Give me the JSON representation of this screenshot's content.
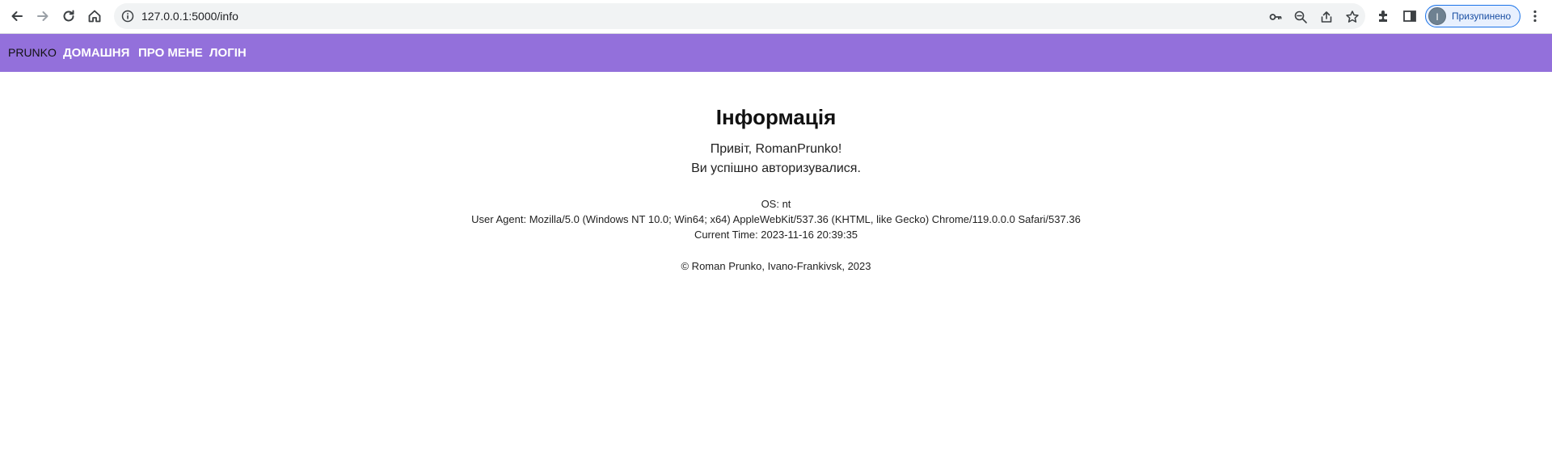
{
  "browser": {
    "url": "127.0.0.1:5000/info",
    "profile_initial": "I",
    "profile_label": "Призупинено",
    "icons": [
      "back-icon",
      "forward-icon",
      "reload-icon",
      "home-icon",
      "info-icon",
      "key-icon",
      "zoom-out-icon",
      "share-icon",
      "star-icon",
      "extensions-icon",
      "sidebar-icon",
      "menu-icon"
    ]
  },
  "navbar": {
    "brand": "PRUNKO",
    "links": [
      "ДОМАШНЯ",
      "ПРО МЕНЕ",
      "ЛОГІН"
    ],
    "background": "#9370db"
  },
  "main": {
    "title": "Інформація",
    "greeting": "Привіт, RomanPrunko!",
    "auth_message": "Ви успішно авторизувалися.",
    "os": "OS: nt",
    "user_agent": "User Agent: Mozilla/5.0 (Windows NT 10.0; Win64; x64) AppleWebKit/537.36 (KHTML, like Gecko) Chrome/119.0.0.0 Safari/537.36",
    "current_time": "Current Time: 2023-11-16 20:39:35",
    "footer": "© Roman Prunko, Ivano-Frankivsk, 2023"
  }
}
